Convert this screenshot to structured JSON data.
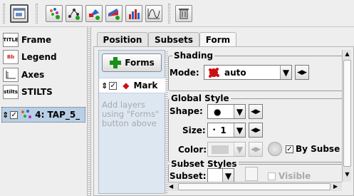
{
  "toolbar": {
    "buttons": [
      "window-icon",
      "add-scatter-icon",
      "add-link-icon",
      "add-vector-icon",
      "add-area-icon",
      "histogram-icon",
      "function-icon",
      "delete-icon"
    ]
  },
  "tree": {
    "items": [
      {
        "label": "Frame",
        "icon_text": "TITLE"
      },
      {
        "label": "Legend",
        "icon_text": "Bb"
      },
      {
        "label": "Axes",
        "icon_text": ""
      },
      {
        "label": "STILTS",
        "icon_text": "stilts"
      },
      {
        "label": "4: TAP_5_",
        "icon_text": ""
      }
    ]
  },
  "tabs": [
    "Position",
    "Subsets",
    "Form"
  ],
  "forms_button": "Forms",
  "layer_row": {
    "checked": true,
    "label": "Mark"
  },
  "hint_text": [
    "Add layers",
    "using \"Forms\"",
    "button above"
  ],
  "shading": {
    "title": "Shading",
    "mode_label": "Mode:",
    "mode_value": "auto"
  },
  "global_style": {
    "title": "Global Style",
    "shape_label": "Shape:",
    "size_label": "Size:",
    "size_value": "1",
    "color_label": "Color:",
    "by_subset_label": "By Subse",
    "by_subset_checked": true
  },
  "subset_styles": {
    "title": "Subset Styles",
    "subset_label": "Subset:",
    "visible_label": "Visible",
    "visible_checked": false
  },
  "colors": {
    "accent_red": "#cc1111",
    "green": "#1a9e1a",
    "blue": "#2255cc"
  }
}
